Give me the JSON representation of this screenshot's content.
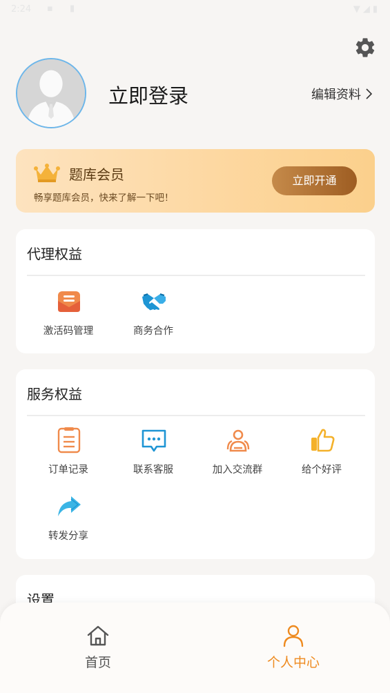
{
  "status_bar": {
    "time": "2:24"
  },
  "profile": {
    "login_label": "立即登录",
    "edit_label": "编辑资料"
  },
  "vip": {
    "title": "题库会员",
    "desc": "畅享题库会员，快来了解一下吧！",
    "button": "立即开通"
  },
  "agent_section": {
    "title": "代理权益",
    "items": [
      {
        "label": "激活码管理",
        "icon": "envelope-icon"
      },
      {
        "label": "商务合作",
        "icon": "handshake-icon"
      }
    ]
  },
  "service_section": {
    "title": "服务权益",
    "items": [
      {
        "label": "订单记录",
        "icon": "order-list-icon"
      },
      {
        "label": "联系客服",
        "icon": "chat-icon"
      },
      {
        "label": "加入交流群",
        "icon": "group-icon"
      },
      {
        "label": "给个好评",
        "icon": "thumbs-up-icon"
      },
      {
        "label": "转发分享",
        "icon": "share-icon"
      }
    ]
  },
  "settings_section": {
    "title": "设置"
  },
  "bottom_nav": {
    "items": [
      {
        "label": "首页",
        "icon": "home-icon",
        "active": false
      },
      {
        "label": "个人中心",
        "icon": "person-icon",
        "active": true
      }
    ]
  },
  "colors": {
    "accent": "#ee8a1f",
    "inactive": "#555555"
  }
}
